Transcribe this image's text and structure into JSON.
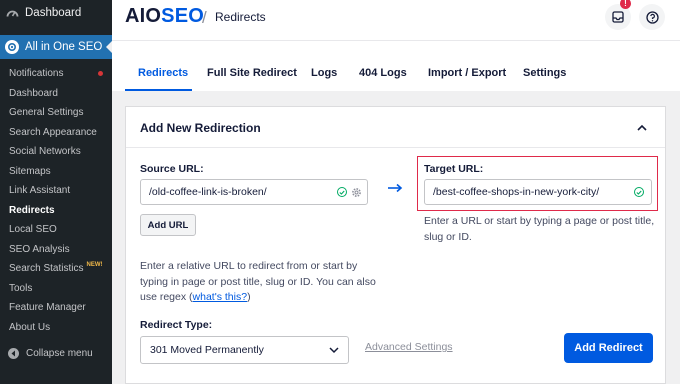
{
  "sidebar": {
    "dashboard_label": "Dashboard",
    "plugin_label": "All in One SEO",
    "items": [
      {
        "label": "Notifications",
        "dot": true
      },
      {
        "label": "Dashboard"
      },
      {
        "label": "General Settings"
      },
      {
        "label": "Search Appearance"
      },
      {
        "label": "Social Networks"
      },
      {
        "label": "Sitemaps"
      },
      {
        "label": "Link Assistant"
      },
      {
        "label": "Redirects",
        "active": true
      },
      {
        "label": "Local SEO"
      },
      {
        "label": "SEO Analysis"
      },
      {
        "label": "Search Statistics",
        "badge": "NEW!"
      },
      {
        "label": "Tools"
      },
      {
        "label": "Feature Manager"
      },
      {
        "label": "About Us"
      }
    ],
    "collapse_label": "Collapse menu"
  },
  "header": {
    "logo_aio": "AIO",
    "logo_seo": "SEO",
    "separator": "/",
    "breadcrumb": "Redirects",
    "notification_count": "!"
  },
  "tabs": [
    {
      "label": "Redirects",
      "active": true
    },
    {
      "label": "Full Site Redirect"
    },
    {
      "label": "Logs"
    },
    {
      "label": "404 Logs"
    },
    {
      "label": "Import / Export"
    },
    {
      "label": "Settings"
    }
  ],
  "card": {
    "title": "Add New Redirection",
    "source_label": "Source URL:",
    "source_value": "/old-coffee-link-is-broken/",
    "add_url_label": "Add URL",
    "source_help_1": "Enter a relative URL to redirect from or start by",
    "source_help_2": "typing in page or post title, slug or ID. You can also",
    "source_help_3a": "use regex (",
    "source_help_link": "what's this?",
    "source_help_3b": ")",
    "target_label": "Target URL:",
    "target_value": "/best-coffee-shops-in-new-york-city/",
    "target_help_1": "Enter a URL or start by typing a page or post title,",
    "target_help_2": "slug or ID.",
    "redirect_type_label": "Redirect Type:",
    "redirect_type_value": "301 Moved Permanently",
    "advanced_label": "Advanced Settings",
    "add_redirect_label": "Add Redirect"
  },
  "colors": {
    "accent": "#005ae0",
    "sidebar_bg": "#1d2327",
    "sidebar_active": "#2271b1",
    "highlight_border": "#df2a4a",
    "valid_check": "#00aa63"
  }
}
